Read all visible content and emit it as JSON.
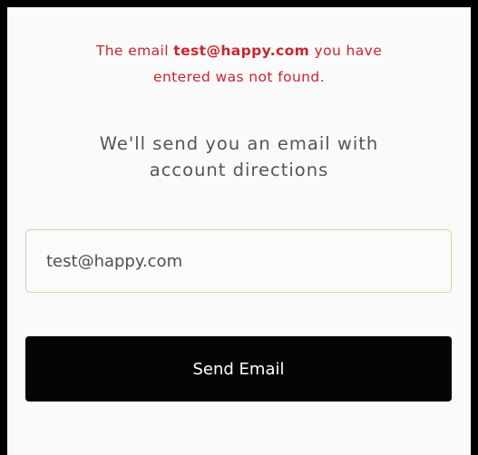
{
  "error": {
    "prefix": "The email ",
    "email": "test@happy.com",
    "suffix": " you have",
    "line2": "entered was not found."
  },
  "info": {
    "line1": "We'll send you an email with",
    "line2": "account directions"
  },
  "email_field": {
    "value": "test@happy.com"
  },
  "send_button": {
    "label": "Send Email"
  },
  "colors": {
    "error": "#c8252c",
    "input_border": "#b9dfa6",
    "button_bg": "#050505",
    "page_border": "#000000"
  }
}
